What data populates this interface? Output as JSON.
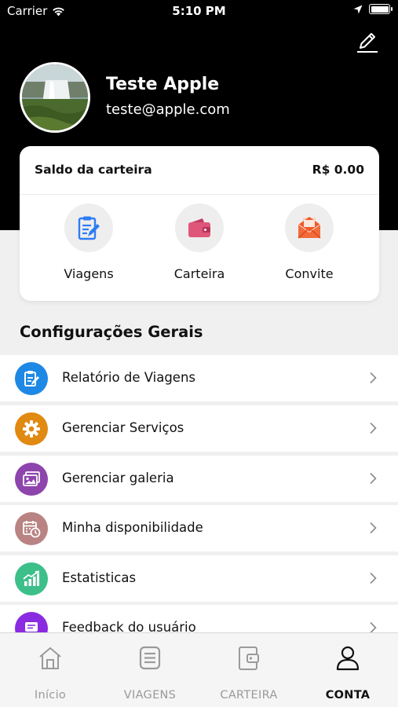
{
  "status_bar": {
    "carrier": "Carrier",
    "time": "5:10 PM"
  },
  "profile": {
    "name": "Teste Apple",
    "email": "teste@apple.com"
  },
  "wallet": {
    "label": "Saldo da carteira",
    "amount": "R$ 0.00",
    "actions": [
      {
        "label": "Viagens",
        "icon": "clipboard-icon",
        "color": "#2e7cf6"
      },
      {
        "label": "Carteira",
        "icon": "wallet-icon",
        "color": "#e0567a"
      },
      {
        "label": "Convite",
        "icon": "envelope-icon",
        "color": "#f05a28"
      }
    ]
  },
  "settings": {
    "title": "Configurações Gerais",
    "items": [
      {
        "label": "Relatório de Viagens",
        "icon": "report-icon",
        "color": "#1e88e5"
      },
      {
        "label": "Gerenciar Serviços",
        "icon": "gear-icon",
        "color": "#e08a12"
      },
      {
        "label": "Gerenciar galeria",
        "icon": "gallery-icon",
        "color": "#8e44ad"
      },
      {
        "label": "Minha disponibilidade",
        "icon": "calendar-clock-icon",
        "color": "#b98383"
      },
      {
        "label": "Estatisticas",
        "icon": "stats-icon",
        "color": "#3dbf8a"
      },
      {
        "label": "Feedback do usuário",
        "icon": "feedback-icon",
        "color": "#8a2be2"
      }
    ]
  },
  "tabbar": {
    "tabs": [
      {
        "label": "Início",
        "icon": "home-icon"
      },
      {
        "label": "VIAGENS",
        "icon": "list-icon"
      },
      {
        "label": "CARTEIRA",
        "icon": "wallet-icon"
      },
      {
        "label": "CONTA",
        "icon": "user-icon",
        "active": true
      }
    ]
  }
}
